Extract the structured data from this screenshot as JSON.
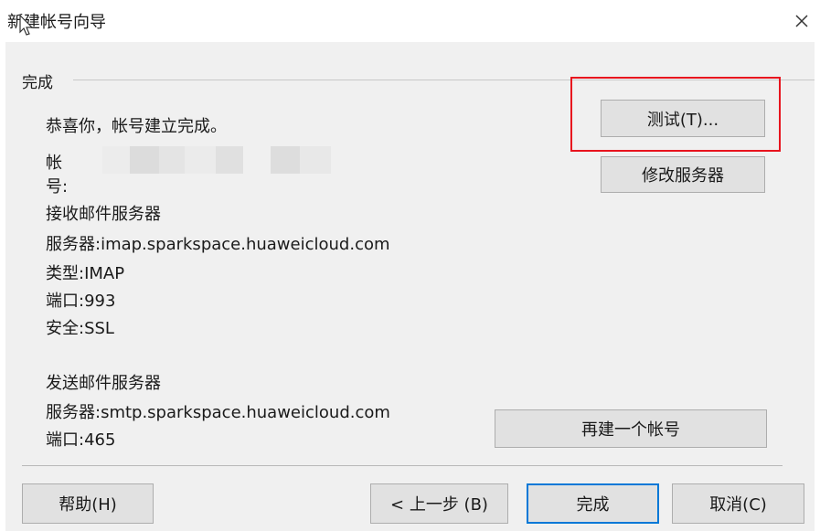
{
  "window": {
    "title": "新建帐号向导",
    "close": "×"
  },
  "group": {
    "label": "完成"
  },
  "summary": {
    "congrats": "恭喜你，帐号建立完成。",
    "account_label": "帐号:",
    "account_value": ""
  },
  "incoming": {
    "heading": "接收邮件服务器",
    "server": "服务器:imap.sparkspace.huaweicloud.com",
    "type": "类型:IMAP",
    "port": "端口:993",
    "security": "安全:SSL"
  },
  "outgoing": {
    "heading": "发送邮件服务器",
    "server": "服务器:smtp.sparkspace.huaweicloud.com",
    "port": "端口:465"
  },
  "buttons": {
    "test": "测试(T)...",
    "modify_server": "修改服务器",
    "new_account": "再建一个帐号",
    "help": "帮助(H)",
    "back": "< 上一步 (B)",
    "finish": "完成",
    "cancel": "取消(C)"
  },
  "colors": {
    "highlight": "#e8141e",
    "primary_border": "#0078d7",
    "button_bg": "#e1e1e1",
    "panel_bg": "#f0f0f0"
  },
  "icons": {
    "cursor": "mouse-pointer-icon",
    "close": "close-icon"
  }
}
